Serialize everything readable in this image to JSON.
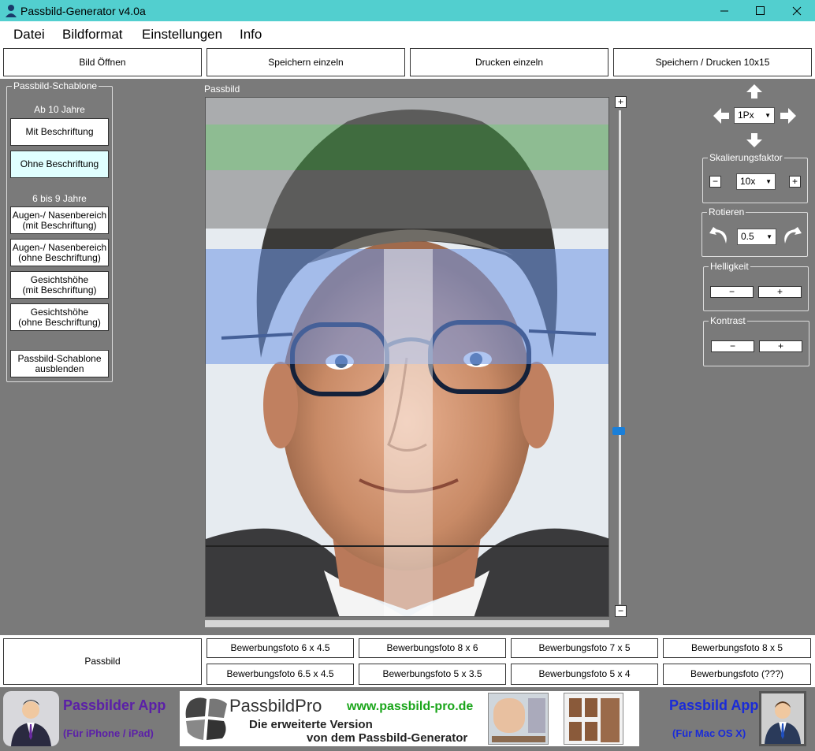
{
  "window": {
    "title": "Passbild-Generator v4.0a",
    "icons": [
      "app-icon",
      "minimize-icon",
      "maximize-icon",
      "close-icon"
    ]
  },
  "menu": {
    "items": [
      "Datei",
      "Bildformat",
      "Einstellungen",
      "Info"
    ]
  },
  "toolbar": {
    "buttons": [
      "Bild Öffnen",
      "Speichern einzeln",
      "Drucken einzeln",
      "Speichern / Drucken 10x15"
    ]
  },
  "sidebar": {
    "group_title": "Passbild-Schablone",
    "section1": "Ab 10 Jahre",
    "btn_mit": "Mit Beschriftung",
    "btn_ohne": "Ohne Beschriftung",
    "section2": "6 bis 9 Jahre",
    "btn_augen_mit_1": "Augen-/ Nasenbereich",
    "btn_augen_mit_2": "(mit Beschriftung)",
    "btn_augen_ohne_1": "Augen-/ Nasenbereich",
    "btn_augen_ohne_2": "(ohne Beschriftung)",
    "btn_gesicht_mit_1": "Gesichtshöhe",
    "btn_gesicht_mit_2": "(mit Beschriftung)",
    "btn_gesicht_ohne_1": "Gesichtshöhe",
    "btn_gesicht_ohne_2": "(ohne Beschriftung)",
    "btn_hide_1": "Passbild-Schablone",
    "btn_hide_2": "ausblenden",
    "selected_color": "#e0ffff"
  },
  "center": {
    "label": "Passbild",
    "slider_plus": "+",
    "slider_minus": "−",
    "slider_thumb_color": "#1a7fd9"
  },
  "right": {
    "move_step": "1Px",
    "scale_label": "Skalierungsfaktor",
    "scale_value": "10x",
    "rotate_label": "Rotieren",
    "rotate_value": "0.5",
    "brightness_label": "Helligkeit",
    "contrast_label": "Kontrast",
    "minus": "−",
    "plus": "+",
    "icons": [
      "arrow-up-icon",
      "arrow-left-icon",
      "arrow-right-icon",
      "arrow-down-icon",
      "rotate-left-icon",
      "rotate-right-icon"
    ]
  },
  "formats": {
    "passbild": "Passbild",
    "items": [
      "Bewerbungsfoto 6 x 4.5",
      "Bewerbungsfoto 8 x 6",
      "Bewerbungsfoto 7 x 5",
      "Bewerbungsfoto 8 x 5",
      "Bewerbungsfoto 6.5 x 4.5",
      "Bewerbungsfoto 5 x 3.5",
      "Bewerbungsfoto 5 x 4",
      "Bewerbungsfoto (???)"
    ]
  },
  "footer": {
    "left_title": "Passbilder App",
    "left_sub": "(Für iPhone / iPad)",
    "banner_logo": "PassbildPro",
    "banner_url": "www.passbild-pro.de",
    "banner_line1": "Die erweiterte Version",
    "banner_line2": "von dem Passbild-Generator",
    "right_title": "Passbild App",
    "right_sub": "(Für Mac OS X)",
    "accent_purple": "#5b1fa8",
    "accent_blue": "#1a2bd8",
    "url_green": "#1aa51a"
  }
}
